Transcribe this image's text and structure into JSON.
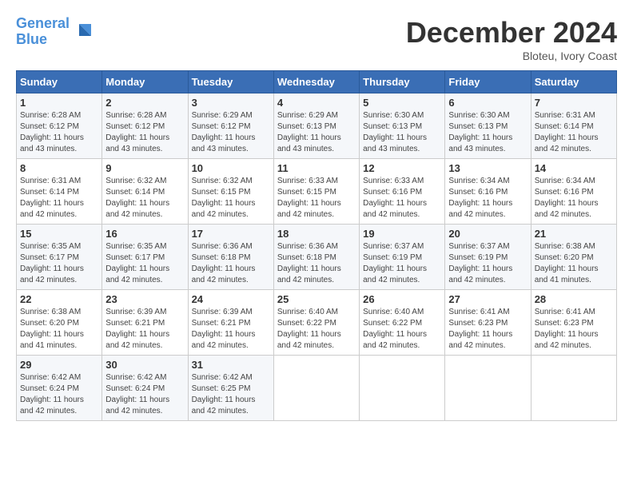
{
  "header": {
    "logo_line1": "General",
    "logo_line2": "Blue",
    "month": "December 2024",
    "location": "Bloteu, Ivory Coast"
  },
  "days_of_week": [
    "Sunday",
    "Monday",
    "Tuesday",
    "Wednesday",
    "Thursday",
    "Friday",
    "Saturday"
  ],
  "weeks": [
    [
      {
        "day": "1",
        "info": "Sunrise: 6:28 AM\nSunset: 6:12 PM\nDaylight: 11 hours\nand 43 minutes."
      },
      {
        "day": "2",
        "info": "Sunrise: 6:28 AM\nSunset: 6:12 PM\nDaylight: 11 hours\nand 43 minutes."
      },
      {
        "day": "3",
        "info": "Sunrise: 6:29 AM\nSunset: 6:12 PM\nDaylight: 11 hours\nand 43 minutes."
      },
      {
        "day": "4",
        "info": "Sunrise: 6:29 AM\nSunset: 6:13 PM\nDaylight: 11 hours\nand 43 minutes."
      },
      {
        "day": "5",
        "info": "Sunrise: 6:30 AM\nSunset: 6:13 PM\nDaylight: 11 hours\nand 43 minutes."
      },
      {
        "day": "6",
        "info": "Sunrise: 6:30 AM\nSunset: 6:13 PM\nDaylight: 11 hours\nand 43 minutes."
      },
      {
        "day": "7",
        "info": "Sunrise: 6:31 AM\nSunset: 6:14 PM\nDaylight: 11 hours\nand 42 minutes."
      }
    ],
    [
      {
        "day": "8",
        "info": "Sunrise: 6:31 AM\nSunset: 6:14 PM\nDaylight: 11 hours\nand 42 minutes."
      },
      {
        "day": "9",
        "info": "Sunrise: 6:32 AM\nSunset: 6:14 PM\nDaylight: 11 hours\nand 42 minutes."
      },
      {
        "day": "10",
        "info": "Sunrise: 6:32 AM\nSunset: 6:15 PM\nDaylight: 11 hours\nand 42 minutes."
      },
      {
        "day": "11",
        "info": "Sunrise: 6:33 AM\nSunset: 6:15 PM\nDaylight: 11 hours\nand 42 minutes."
      },
      {
        "day": "12",
        "info": "Sunrise: 6:33 AM\nSunset: 6:16 PM\nDaylight: 11 hours\nand 42 minutes."
      },
      {
        "day": "13",
        "info": "Sunrise: 6:34 AM\nSunset: 6:16 PM\nDaylight: 11 hours\nand 42 minutes."
      },
      {
        "day": "14",
        "info": "Sunrise: 6:34 AM\nSunset: 6:16 PM\nDaylight: 11 hours\nand 42 minutes."
      }
    ],
    [
      {
        "day": "15",
        "info": "Sunrise: 6:35 AM\nSunset: 6:17 PM\nDaylight: 11 hours\nand 42 minutes."
      },
      {
        "day": "16",
        "info": "Sunrise: 6:35 AM\nSunset: 6:17 PM\nDaylight: 11 hours\nand 42 minutes."
      },
      {
        "day": "17",
        "info": "Sunrise: 6:36 AM\nSunset: 6:18 PM\nDaylight: 11 hours\nand 42 minutes."
      },
      {
        "day": "18",
        "info": "Sunrise: 6:36 AM\nSunset: 6:18 PM\nDaylight: 11 hours\nand 42 minutes."
      },
      {
        "day": "19",
        "info": "Sunrise: 6:37 AM\nSunset: 6:19 PM\nDaylight: 11 hours\nand 42 minutes."
      },
      {
        "day": "20",
        "info": "Sunrise: 6:37 AM\nSunset: 6:19 PM\nDaylight: 11 hours\nand 42 minutes."
      },
      {
        "day": "21",
        "info": "Sunrise: 6:38 AM\nSunset: 6:20 PM\nDaylight: 11 hours\nand 41 minutes."
      }
    ],
    [
      {
        "day": "22",
        "info": "Sunrise: 6:38 AM\nSunset: 6:20 PM\nDaylight: 11 hours\nand 41 minutes."
      },
      {
        "day": "23",
        "info": "Sunrise: 6:39 AM\nSunset: 6:21 PM\nDaylight: 11 hours\nand 42 minutes."
      },
      {
        "day": "24",
        "info": "Sunrise: 6:39 AM\nSunset: 6:21 PM\nDaylight: 11 hours\nand 42 minutes."
      },
      {
        "day": "25",
        "info": "Sunrise: 6:40 AM\nSunset: 6:22 PM\nDaylight: 11 hours\nand 42 minutes."
      },
      {
        "day": "26",
        "info": "Sunrise: 6:40 AM\nSunset: 6:22 PM\nDaylight: 11 hours\nand 42 minutes."
      },
      {
        "day": "27",
        "info": "Sunrise: 6:41 AM\nSunset: 6:23 PM\nDaylight: 11 hours\nand 42 minutes."
      },
      {
        "day": "28",
        "info": "Sunrise: 6:41 AM\nSunset: 6:23 PM\nDaylight: 11 hours\nand 42 minutes."
      }
    ],
    [
      {
        "day": "29",
        "info": "Sunrise: 6:42 AM\nSunset: 6:24 PM\nDaylight: 11 hours\nand 42 minutes."
      },
      {
        "day": "30",
        "info": "Sunrise: 6:42 AM\nSunset: 6:24 PM\nDaylight: 11 hours\nand 42 minutes."
      },
      {
        "day": "31",
        "info": "Sunrise: 6:42 AM\nSunset: 6:25 PM\nDaylight: 11 hours\nand 42 minutes."
      },
      {
        "day": "",
        "info": ""
      },
      {
        "day": "",
        "info": ""
      },
      {
        "day": "",
        "info": ""
      },
      {
        "day": "",
        "info": ""
      }
    ]
  ]
}
